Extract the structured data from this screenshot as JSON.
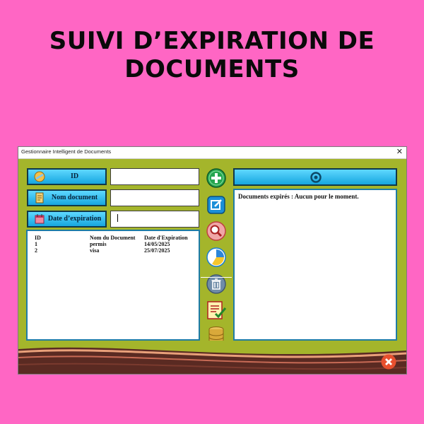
{
  "heading": {
    "line1": "SUIVI D’EXPIRATION DE",
    "line2": "DOCUMENTS"
  },
  "window": {
    "title": "Gestionnaire Intelligent de Documents",
    "close_glyph": "✕"
  },
  "form": {
    "fields": [
      {
        "label": "ID",
        "icon": "coin-icon",
        "value": ""
      },
      {
        "label": "Nom document",
        "icon": "document-icon",
        "value": ""
      },
      {
        "label": "Date d’expiration",
        "icon": "calendar-icon",
        "value": ""
      }
    ]
  },
  "list": {
    "headers": [
      "ID",
      "Nom du Document",
      "Date d'Expiration"
    ],
    "rows": [
      [
        "1",
        "permis",
        "14/05/2025"
      ],
      [
        "2",
        "visa",
        "25/07/2025"
      ]
    ]
  },
  "toolbar": {
    "icons": [
      "add-icon",
      "edit-icon",
      "search-icon",
      "pie-chart-icon",
      "delete-icon",
      "report-icon",
      "database-icon"
    ]
  },
  "status": {
    "message": "Documents expirés : Aucun pour le moment."
  },
  "colors": {
    "background": "#ff66c4",
    "window": "#a4b52b",
    "button": "#16a6df",
    "accent": "#e8502f"
  }
}
